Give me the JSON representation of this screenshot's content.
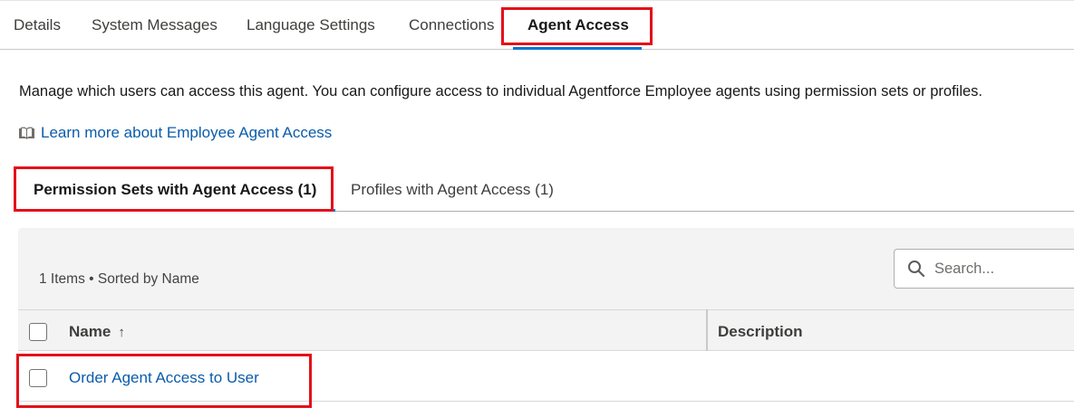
{
  "top_tabs": {
    "details": "Details",
    "system_messages": "System Messages",
    "language_settings": "Language Settings",
    "connections": "Connections",
    "agent_access": "Agent Access"
  },
  "page": {
    "description": "Manage which users can access this agent. You can configure access to individual Agentforce Employee agents using permission sets or profiles.",
    "learn_more_link": "Learn more about Employee Agent Access",
    "learn_more_icon": "book-icon"
  },
  "sub_tabs": {
    "permission_sets": "Permission Sets with Agent Access (1)",
    "profiles": "Profiles with Agent Access (1)"
  },
  "list": {
    "info": "1 Items • Sorted by Name",
    "search_placeholder": "Search...",
    "columns": {
      "name": "Name",
      "name_sort_icon": "↑",
      "description": "Description"
    },
    "rows": [
      {
        "name": "Order Agent Access to User",
        "description": ""
      }
    ]
  },
  "colors": {
    "accent": "#0176d3",
    "link": "#0b5cab",
    "highlight_box": "#e3101a",
    "panel_bg": "#f3f3f3"
  }
}
